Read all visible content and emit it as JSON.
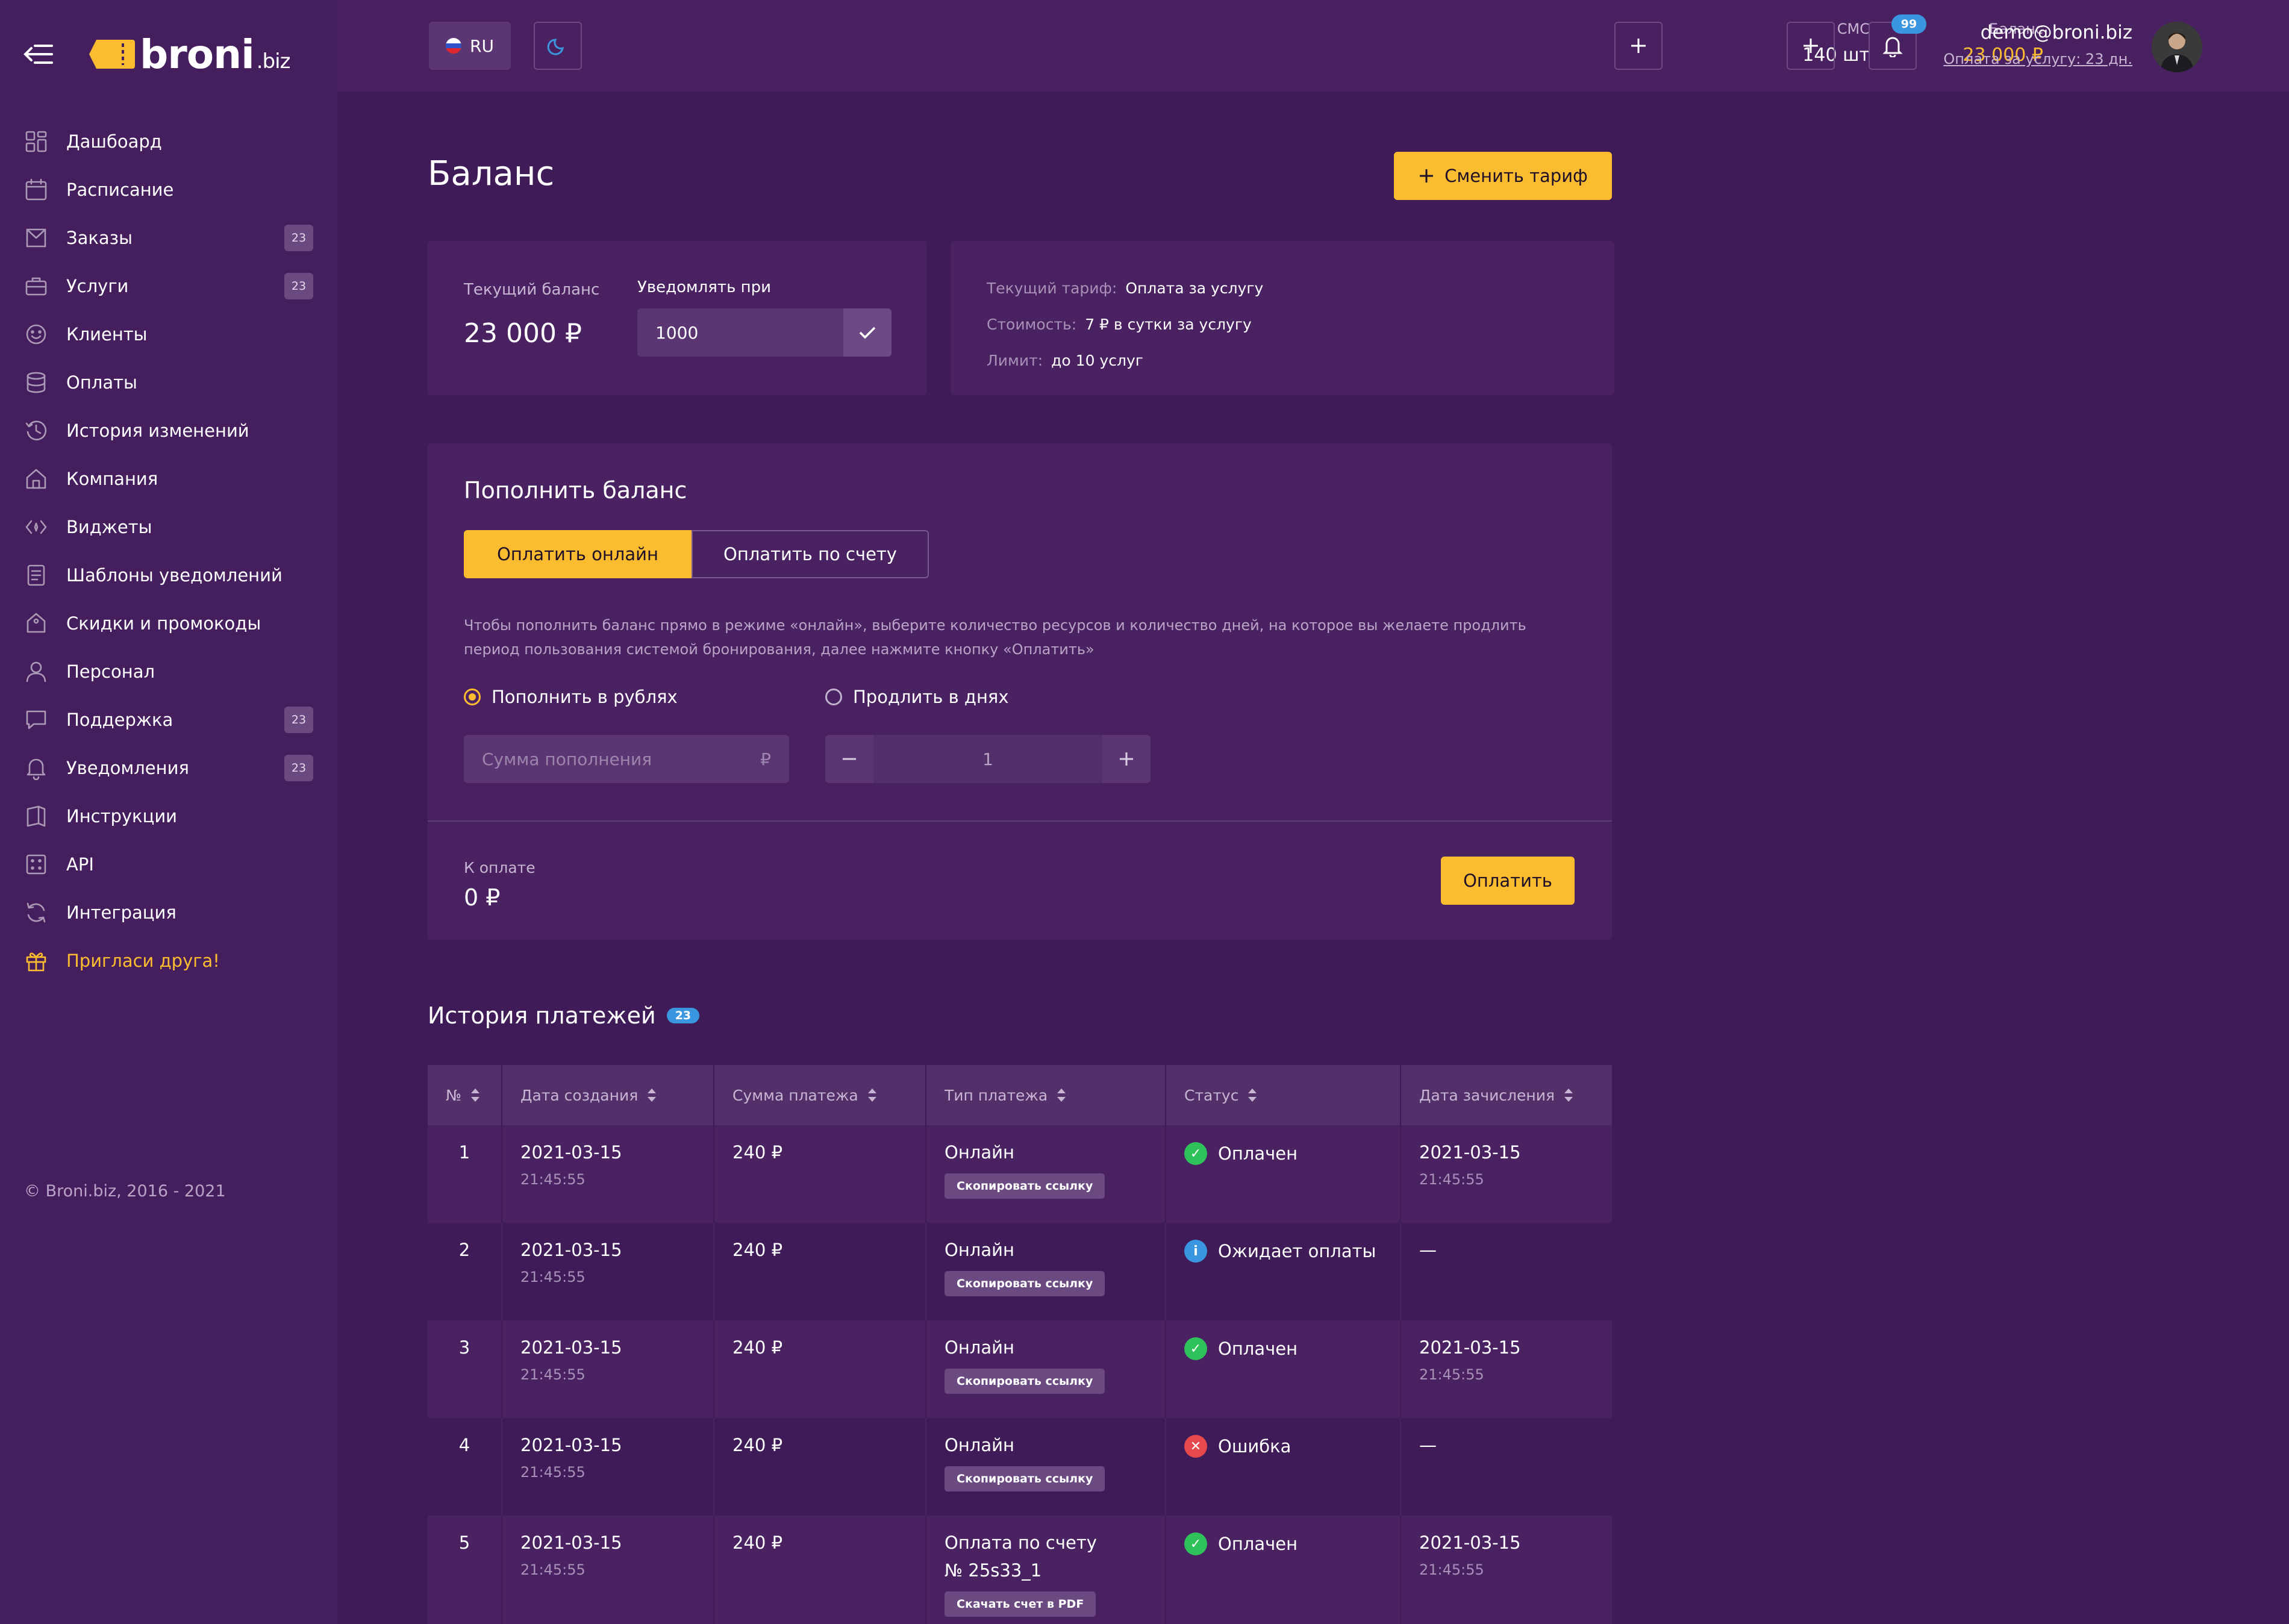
{
  "brand": {
    "name": "broni",
    "tld": ".biz"
  },
  "sidebar": {
    "items": [
      {
        "label": "Дашбоард",
        "icon": "dashboard-icon"
      },
      {
        "label": "Расписание",
        "icon": "calendar-icon"
      },
      {
        "label": "Заказы",
        "icon": "orders-icon",
        "badge": "23"
      },
      {
        "label": "Услуги",
        "icon": "briefcase-icon",
        "badge": "23"
      },
      {
        "label": "Клиенты",
        "icon": "smile-icon"
      },
      {
        "label": "Оплаты",
        "icon": "coins-icon"
      },
      {
        "label": "История изменений",
        "icon": "history-icon"
      },
      {
        "label": "Компания",
        "icon": "home-icon"
      },
      {
        "label": "Виджеты",
        "icon": "widget-icon"
      },
      {
        "label": "Шаблоны уведомлений",
        "icon": "document-icon"
      },
      {
        "label": "Скидки и промокоды",
        "icon": "tag-icon"
      },
      {
        "label": "Персонал",
        "icon": "user-icon"
      },
      {
        "label": "Поддержка",
        "icon": "chat-icon",
        "badge": "23"
      },
      {
        "label": "Уведомления",
        "icon": "bell-icon",
        "badge": "23"
      },
      {
        "label": "Инструкции",
        "icon": "book-icon"
      },
      {
        "label": "API",
        "icon": "api-icon"
      },
      {
        "label": "Интеграция",
        "icon": "sync-icon"
      },
      {
        "label": "Пригласи друга!",
        "icon": "gift-icon"
      }
    ],
    "copyright": "© Broni.biz, 2016 - 2021"
  },
  "topbar": {
    "language": "RU",
    "sms_label": "СМС",
    "sms_value": "140 шт",
    "balance_label": "Баланс",
    "balance_value": "23 000 ₽",
    "notifications_count": "99",
    "user_email": "demo@broni.biz",
    "user_subscription": "Оплата за услугу: 23 дн."
  },
  "page": {
    "title": "Баланс",
    "change_tariff_label": "Сменить тариф"
  },
  "balance": {
    "current_label": "Текущий баланс",
    "current_value": "23 000 ₽",
    "notify_label": "Уведомлять при",
    "notify_value": "1000"
  },
  "tariff": {
    "current_label": "Текущий тариф:",
    "current_value": "Оплата за услугу",
    "cost_label": "Стоимость:",
    "cost_value": "7 ₽ в сутки за услугу",
    "limit_label": "Лимит:",
    "limit_value": "до 10 услуг"
  },
  "topup": {
    "title": "Пополнить баланс",
    "tab_online": "Оплатить онлайн",
    "tab_invoice": "Оплатить по счету",
    "description": "Чтобы пополнить баланс прямо в режиме «онлайн», выберите количество ресурсов и количество дней, на которое вы желаете продлить период пользования системой бронирования, далее нажмите кнопку «Оплатить»",
    "radio_rubles": "Пополнить в рублях",
    "radio_days": "Продлить в днях",
    "amount_placeholder": "Сумма пополнения",
    "currency_symbol": "₽",
    "days_value": "1",
    "to_pay_label": "К оплате",
    "to_pay_value": "0 ₽",
    "pay_button": "Оплатить"
  },
  "history": {
    "title": "История платежей",
    "count": "23",
    "columns": [
      "№",
      "Дата создания",
      "Сумма платежа",
      "Тип платежа",
      "Статус",
      "Дата зачисления"
    ],
    "rows": [
      {
        "num": "1",
        "date": "2021-03-15",
        "time": "21:45:55",
        "amount": "240 ₽",
        "type": "Онлайн",
        "type_sub": "",
        "action": "Скопировать ссылку",
        "status": "Оплачен",
        "status_kind": "success",
        "paid_date": "2021-03-15",
        "paid_time": "21:45:55"
      },
      {
        "num": "2",
        "date": "2021-03-15",
        "time": "21:45:55",
        "amount": "240 ₽",
        "type": "Онлайн",
        "type_sub": "",
        "action": "Скопировать ссылку",
        "status": "Ожидает оплаты",
        "status_kind": "info",
        "paid_date": "—",
        "paid_time": ""
      },
      {
        "num": "3",
        "date": "2021-03-15",
        "time": "21:45:55",
        "amount": "240 ₽",
        "type": "Онлайн",
        "type_sub": "",
        "action": "Скопировать ссылку",
        "status": "Оплачен",
        "status_kind": "success",
        "paid_date": "2021-03-15",
        "paid_time": "21:45:55"
      },
      {
        "num": "4",
        "date": "2021-03-15",
        "time": "21:45:55",
        "amount": "240 ₽",
        "type": "Онлайн",
        "type_sub": "",
        "action": "Скопировать ссылку",
        "status": "Ошибка",
        "status_kind": "error",
        "paid_date": "—",
        "paid_time": ""
      },
      {
        "num": "5",
        "date": "2021-03-15",
        "time": "21:45:55",
        "amount": "240 ₽",
        "type": "Оплата по счету",
        "type_sub": "№ 25s33_1",
        "action": "Скачать счет в PDF",
        "status": "Оплачен",
        "status_kind": "success",
        "paid_date": "2021-03-15",
        "paid_time": "21:45:55"
      }
    ]
  },
  "colors": {
    "accent": "#fbbd2f",
    "background": "#3f1c57",
    "sidebar": "#451e5e",
    "success": "#2fc25b",
    "info": "#3b96e0",
    "error": "#e5484d"
  }
}
